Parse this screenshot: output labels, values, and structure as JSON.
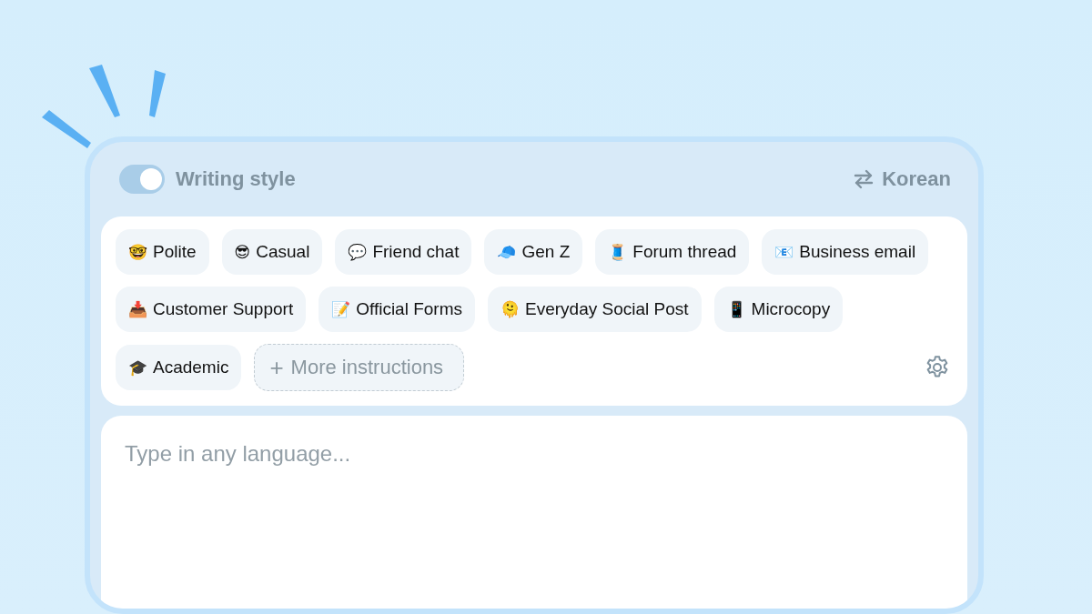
{
  "header": {
    "toggle": {
      "on": true
    },
    "title": "Writing style",
    "language": "Korean"
  },
  "styles": [
    {
      "icon": "🤓",
      "label": "Polite"
    },
    {
      "icon": "😎",
      "label": "Casual"
    },
    {
      "icon": "💬",
      "label": "Friend chat"
    },
    {
      "icon": "🧢",
      "label": "Gen Z"
    },
    {
      "icon": "🧵",
      "label": "Forum thread"
    },
    {
      "icon": "📧",
      "label": "Business email"
    },
    {
      "icon": "📥",
      "label": "Customer Support"
    },
    {
      "icon": "📝",
      "label": "Official Forms"
    },
    {
      "icon": "🫠",
      "label": "Everyday Social Post"
    },
    {
      "icon": "📱",
      "label": "Microcopy"
    },
    {
      "icon": "🎓",
      "label": "Academic"
    }
  ],
  "more_button": {
    "icon": "+",
    "label": "More instructions"
  },
  "input": {
    "placeholder": "Type in any language..."
  }
}
